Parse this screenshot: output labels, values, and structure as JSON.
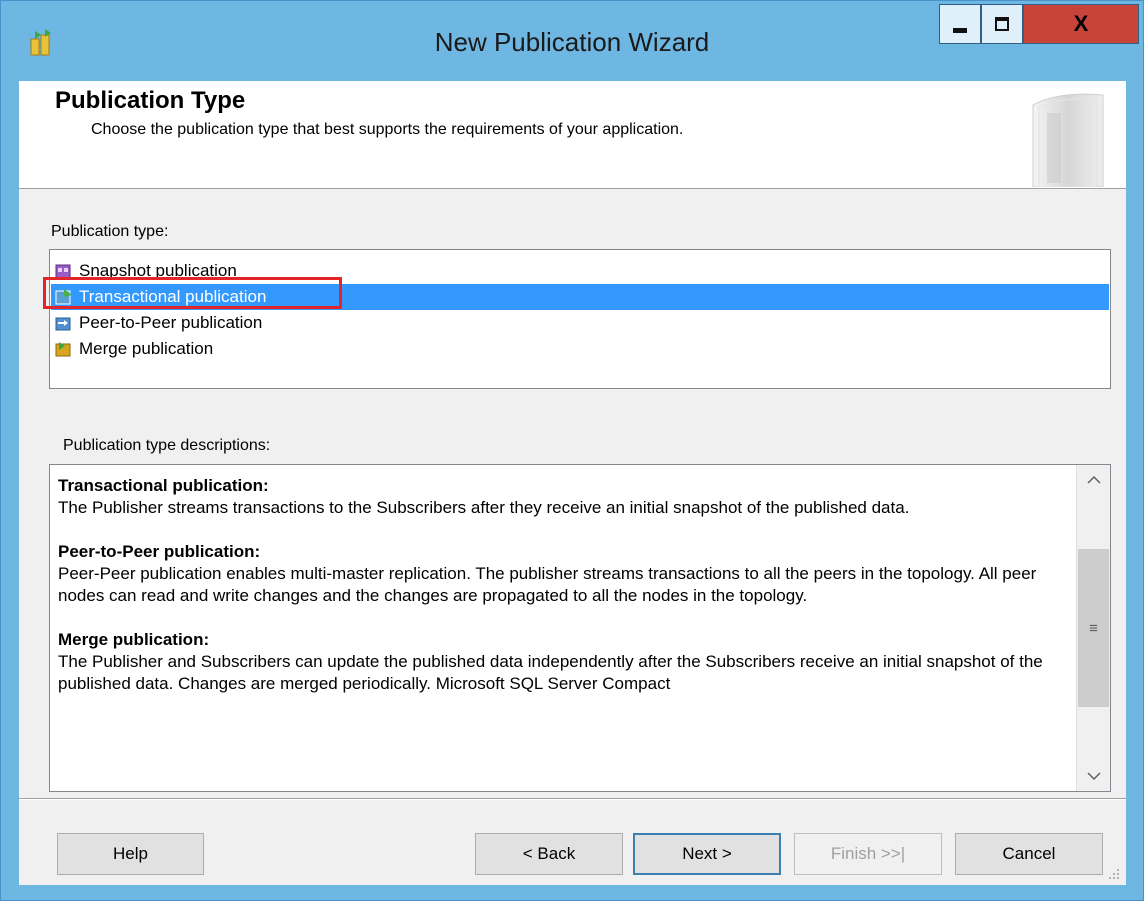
{
  "window": {
    "title": "New Publication Wizard",
    "icons": {
      "app": "replication-wizard-icon",
      "minimize": "minimize-icon",
      "maximize": "maximize-icon",
      "close": "close-icon"
    },
    "close_label": "X"
  },
  "header": {
    "title": "Publication Type",
    "subtitle": "Choose the publication type that best supports the requirements of your application.",
    "graphic_icon": "wizard-header-graphic"
  },
  "publication_type": {
    "label": "Publication type:",
    "selected_index": 1,
    "items": [
      {
        "label": "Snapshot publication",
        "icon": "snapshot-publication-icon"
      },
      {
        "label": "Transactional publication",
        "icon": "transactional-publication-icon"
      },
      {
        "label": "Peer-to-Peer publication",
        "icon": "peer-to-peer-publication-icon"
      },
      {
        "label": "Merge publication",
        "icon": "merge-publication-icon"
      }
    ]
  },
  "descriptions": {
    "label": "Publication type descriptions:",
    "sections": [
      {
        "heading": "Transactional publication:",
        "text": "The Publisher streams transactions to the Subscribers after they receive an initial snapshot of the published data."
      },
      {
        "heading": "Peer-to-Peer publication:",
        "text": "Peer-Peer publication enables multi-master replication. The publisher streams transactions to all the peers in the topology. All peer nodes can read and write changes and the changes are propagated to all the nodes in the topology."
      },
      {
        "heading": "Merge publication:",
        "text": "The Publisher and Subscribers can update the published data independently after the Subscribers receive an initial snapshot of the published data. Changes are merged periodically. Microsoft SQL Server Compact"
      }
    ],
    "scroll_up": "^",
    "scroll_down": "v",
    "scroll_thumb": "≡"
  },
  "buttons": {
    "help": "Help",
    "back": "< Back",
    "next": "Next >",
    "finish": "Finish >>|",
    "cancel": "Cancel"
  },
  "colors": {
    "titlebar": "#6fb7e3",
    "selection": "#3399ff",
    "highlight_box": "#e3242b",
    "close_button": "#c7443b"
  }
}
